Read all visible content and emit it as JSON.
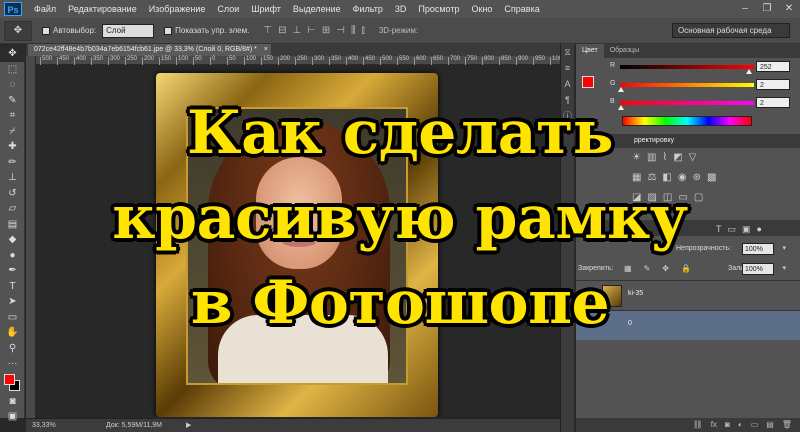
{
  "app": {
    "logo": "Ps"
  },
  "menu": [
    "Файл",
    "Редактирование",
    "Изображение",
    "Слои",
    "Шрифт",
    "Выделение",
    "Фильтр",
    "3D",
    "Просмотр",
    "Окно",
    "Справка"
  ],
  "window_controls": [
    "–",
    "❐",
    "✕"
  ],
  "options_bar": {
    "auto_select_label": "Автовыбор:",
    "auto_select_value": "Слой",
    "show_transform_label": "Показать упр. элем.",
    "mode_3d_label": "3D-режим:",
    "workspace": "Основная рабочая среда"
  },
  "document": {
    "tab_title": "072ce42ff48e4b7b034a7eb6154fcb61.jpe @ 33,3% (Слой 0, RGB/8#) *",
    "close": "×",
    "ruler_ticks": [
      "500",
      "450",
      "400",
      "350",
      "300",
      "250",
      "200",
      "150",
      "100",
      "50",
      "0",
      "50",
      "100",
      "150",
      "200",
      "250",
      "300",
      "350",
      "400",
      "450",
      "500",
      "550",
      "600",
      "650",
      "700",
      "750",
      "800",
      "850",
      "900",
      "950",
      "1000"
    ]
  },
  "headline": {
    "line1": "Как сделать",
    "line2": "красивую рамку",
    "line3": "в Фотошопе"
  },
  "status": {
    "zoom": "33,33%",
    "doc_info": "Док: 5,59M/11,9M",
    "arrow": "▶"
  },
  "colors": {
    "foreground": "#fe0202",
    "background": "#000000",
    "accent_selected_layer": "#5d6e88",
    "headline": "#ffe400"
  },
  "color_panel": {
    "tabs": [
      "Цвет",
      "Образцы"
    ],
    "channels": [
      {
        "label": "R",
        "value": "252",
        "level": 0.99
      },
      {
        "label": "G",
        "value": "2",
        "level": 0.01
      },
      {
        "label": "B",
        "value": "2",
        "level": 0.01
      }
    ]
  },
  "adjustments": {
    "header": "рректировку"
  },
  "layers": {
    "opacity_label": "Непрозрачность:",
    "opacity_value": "100%",
    "fill_label": "Заливка:",
    "fill_value": "100%",
    "lock_label": "Закрепить:",
    "items": [
      {
        "name": "ki-35"
      },
      {
        "name": "0"
      }
    ]
  }
}
